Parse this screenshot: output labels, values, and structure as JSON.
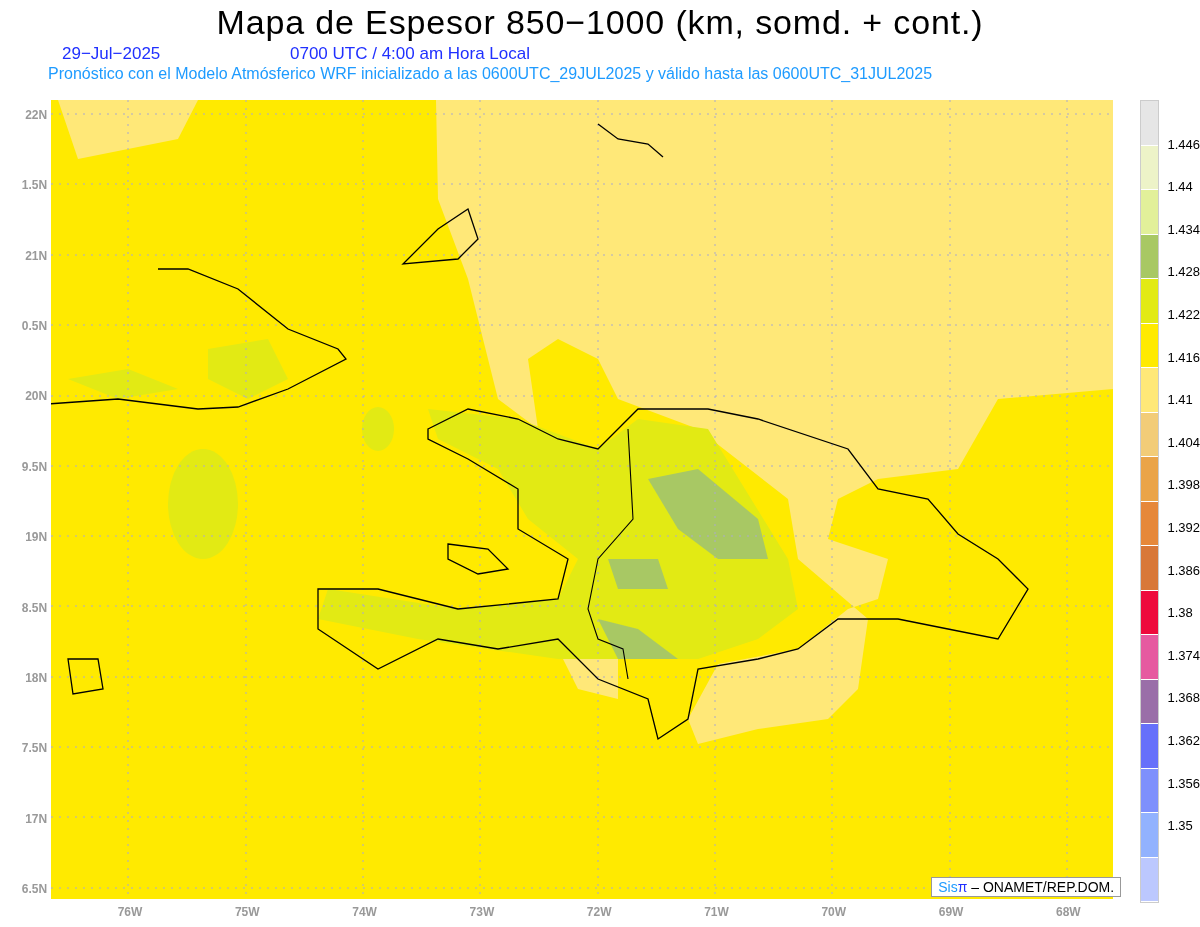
{
  "title": "Mapa de Espesor 850−1000 (km, somd. + cont.)",
  "subtitle": {
    "date": "29−Jul−2025",
    "time": "0700 UTC / 4:00 am Hora Local"
  },
  "description": "Pronóstico con el Modelo Atmósferico WRF inicializado a las 0600UTC_29JUL2025 y válido hasta las  0600UTC_31JUL2025",
  "y_axis": [
    "22N",
    "1.5N",
    "21N",
    "0.5N",
    "20N",
    "9.5N",
    "19N",
    "8.5N",
    "18N",
    "7.5N",
    "17N",
    "6.5N"
  ],
  "x_axis": [
    "76W",
    "75W",
    "74W",
    "73W",
    "72W",
    "71W",
    "70W",
    "69W",
    "68W"
  ],
  "legend": {
    "bands": [
      {
        "color": "#e6e6e6"
      },
      {
        "color": "#edf3c8"
      },
      {
        "color": "#e2f09a"
      },
      {
        "color": "#a8c864"
      },
      {
        "color": "#e2ea14"
      },
      {
        "color": "#ffea00"
      },
      {
        "color": "#ffe878"
      },
      {
        "color": "#f2cc78"
      },
      {
        "color": "#eaa448"
      },
      {
        "color": "#e6883a"
      },
      {
        "color": "#d87838"
      },
      {
        "color": "#ee0a3c"
      },
      {
        "color": "#e65aa0"
      },
      {
        "color": "#9a6ea8"
      },
      {
        "color": "#6670fa"
      },
      {
        "color": "#7e90fc"
      },
      {
        "color": "#92b2fe"
      },
      {
        "color": "#bcc8fe"
      }
    ],
    "labels": [
      "1.446",
      "1.44",
      "1.434",
      "1.428",
      "1.422",
      "1.416",
      "1.41",
      "1.404",
      "1.398",
      "1.392",
      "1.386",
      "1.38",
      "1.374",
      "1.368",
      "1.362",
      "1.356",
      "1.35"
    ]
  },
  "credit": {
    "brand": "Sis",
    "symbol": "π",
    "text": "– ONAMET/REP.DOM."
  }
}
